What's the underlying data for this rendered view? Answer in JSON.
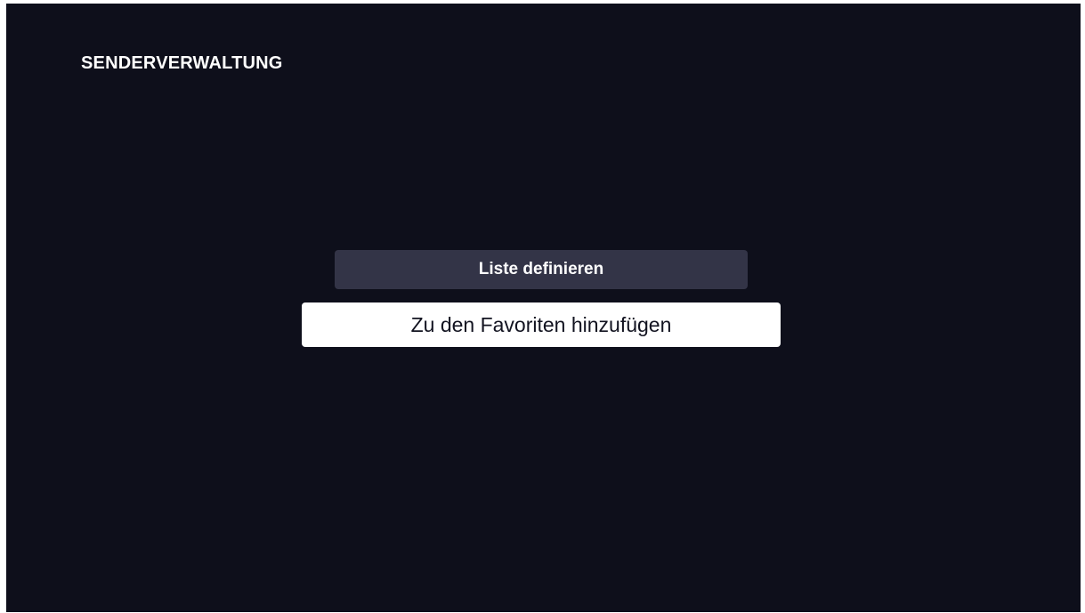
{
  "header": {
    "title": "SENDERVERWALTUNG"
  },
  "menu": {
    "items": [
      {
        "label": "Liste definieren",
        "focused": false
      },
      {
        "label": "Zu den Favoriten hinzufügen",
        "focused": true
      }
    ]
  },
  "colors": {
    "background": "#0e0f1b",
    "button_default": "#333447",
    "button_focused": "#ffffff",
    "text_light": "#ffffff",
    "text_dark": "#121320"
  }
}
